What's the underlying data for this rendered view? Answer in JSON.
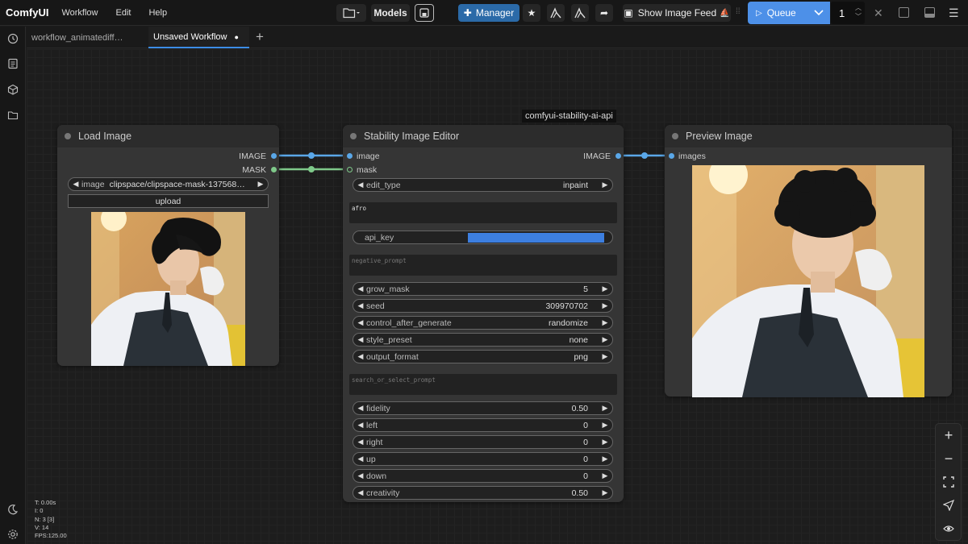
{
  "app": {
    "title": "ComfyUI",
    "menu": [
      "Workflow",
      "Edit",
      "Help"
    ]
  },
  "toolbar": {
    "models_label": "Models",
    "manager_label": "Manager",
    "image_feed_label": "Show Image Feed",
    "queue_label": "Queue",
    "queue_count": "1"
  },
  "tabs": [
    {
      "label": "workflow_animatediff…",
      "active": false
    },
    {
      "label": "Unsaved Workflow",
      "active": true,
      "unsaved_dot": "●"
    }
  ],
  "badge": "comfyui-stability-ai-api",
  "nodes": {
    "load_image": {
      "title": "Load Image",
      "outputs": [
        "IMAGE",
        "MASK"
      ],
      "image_widget": {
        "name": "image",
        "value": "clipspace/clipspace-mask-137568…"
      },
      "upload_label": "upload"
    },
    "editor": {
      "title": "Stability Image Editor",
      "inputs": [
        "image",
        "mask"
      ],
      "outputs": [
        "IMAGE"
      ],
      "edit_type": {
        "name": "edit_type",
        "value": "inpaint"
      },
      "prompt": "afro",
      "api_key": {
        "name": "api_key"
      },
      "negative_prompt_placeholder": "negative_prompt",
      "widgets_a": [
        {
          "name": "grow_mask",
          "value": "5"
        },
        {
          "name": "seed",
          "value": "309970702"
        },
        {
          "name": "control_after_generate",
          "value": "randomize"
        },
        {
          "name": "style_preset",
          "value": "none"
        },
        {
          "name": "output_format",
          "value": "png"
        }
      ],
      "search_placeholder": "search_or_select_prompt",
      "widgets_b": [
        {
          "name": "fidelity",
          "value": "0.50"
        },
        {
          "name": "left",
          "value": "0"
        },
        {
          "name": "right",
          "value": "0"
        },
        {
          "name": "up",
          "value": "0"
        },
        {
          "name": "down",
          "value": "0"
        },
        {
          "name": "creativity",
          "value": "0.50"
        }
      ]
    },
    "preview": {
      "title": "Preview Image",
      "inputs": [
        "images"
      ]
    }
  },
  "stats": {
    "t": "T: 0.00s",
    "i": "I: 0",
    "n": "N: 3 [3]",
    "v": "V: 14",
    "fps": "FPS:125.00"
  },
  "colors": {
    "accent": "#4d90e8",
    "image_link": "#5aa7e8",
    "mask_link": "#7fc98a"
  }
}
